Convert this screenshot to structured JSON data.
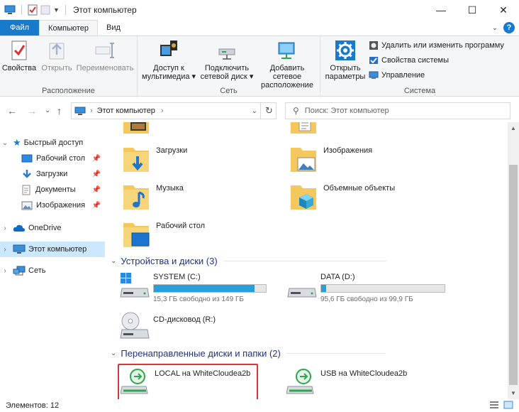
{
  "window": {
    "title": "Этот компьютер",
    "controls": [
      "minimize-icon",
      "maximize-icon",
      "close-icon"
    ]
  },
  "ribbon_tabs": [
    {
      "label": "Файл"
    },
    {
      "label": "Компьютер"
    },
    {
      "label": "Вид"
    }
  ],
  "ribbon": {
    "groups": {
      "location": "Расположение",
      "network": "Сеть",
      "system": "Система"
    },
    "buttons": {
      "properties": "Свойства",
      "open": "Открыть",
      "rename": "Переименовать",
      "media_line1": "Доступ к",
      "media_line2": "мультимедиа",
      "map_drive_line1": "Подключить",
      "map_drive_line2": "сетевой диск",
      "add_location_line1": "Добавить сетевое",
      "add_location_line2": "расположение",
      "open_settings_line1": "Открыть",
      "open_settings_line2": "параметры",
      "uninstall": "Удалить или изменить программу",
      "system_props": "Свойства системы",
      "manage": "Управление"
    }
  },
  "address": {
    "path": "Этот компьютер",
    "search_placeholder": "Поиск: Этот компьютер"
  },
  "nav": {
    "quick_access": "Быстрый доступ",
    "desktop": "Рабочий стол",
    "downloads": "Загрузки",
    "documents": "Документы",
    "pictures": "Изображения",
    "onedrive": "OneDrive",
    "this_pc": "Этот компьютер",
    "network": "Сеть"
  },
  "folders": {
    "downloads": "Загрузки",
    "pictures": "Изображения",
    "music": "Музыка",
    "objects3d": "Объемные объекты",
    "desktop": "Рабочий стол"
  },
  "sections": {
    "devices": "Устройства и диски (3)",
    "redirected": "Перенаправленные диски и папки (2)"
  },
  "drives": {
    "c": {
      "name": "SYSTEM (C:)",
      "free": "15,3 ГБ свободно из 149 ГБ",
      "used_fraction": 0.897
    },
    "d": {
      "name": "DATA (D:)",
      "free": "95,6 ГБ свободно из 99,9 ГБ",
      "used_fraction": 0.043
    },
    "r": {
      "name": "CD-дисковод (R:)"
    }
  },
  "redirected": {
    "local": "LOCAL на WhiteCloudea2b",
    "usb": "USB на WhiteCloudea2b"
  },
  "status": {
    "items": "Элементов: 12"
  },
  "colors": {
    "accent": "#1979ca",
    "selection": "#cce8ff",
    "bar_fill": "#26a0da",
    "highlight": "#d9343a"
  }
}
